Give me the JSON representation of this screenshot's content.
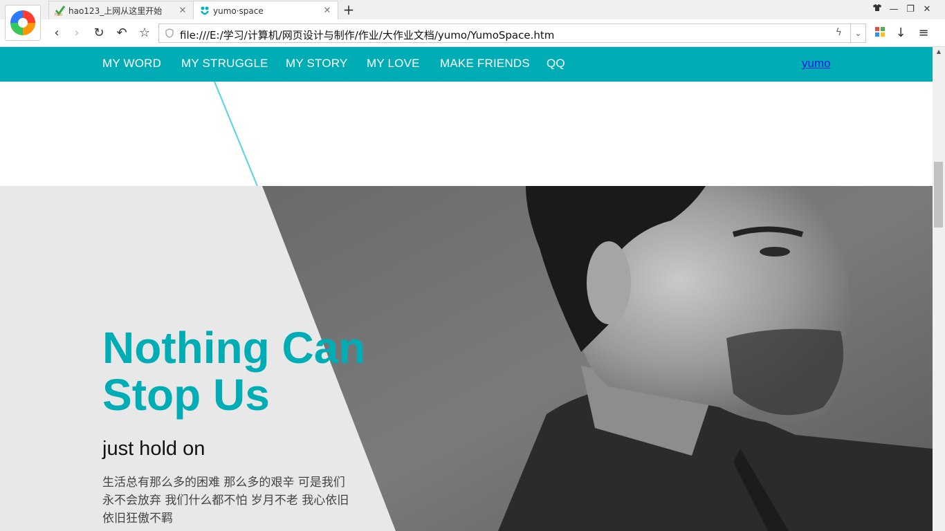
{
  "browser": {
    "tabs": [
      {
        "title": "hao123_上网从这里开始",
        "active": false,
        "icon": "hao123-favicon"
      },
      {
        "title": "yumo·space",
        "active": true,
        "icon": "yumo-favicon"
      }
    ],
    "address_url": "file:///E:/学习/计算机/网页设计与制作/作业/大作业文档/yumo/YumoSpace.htm"
  },
  "nav": {
    "items": [
      "MY WORD",
      "MY STRUGGLE",
      "MY STORY",
      "MY LOVE",
      "MAKE FRIENDS",
      "QQ"
    ],
    "user_link": "yumo"
  },
  "hero": {
    "heading_line1": "Nothing Can",
    "heading_line2": "Stop Us",
    "subheading": "just hold on",
    "body": "生活总有那么多的困难 那么多的艰辛 可是我们永不会放弃 我们什么都不怕 岁月不老 我心依旧 依旧狂傲不羁"
  },
  "colors": {
    "accent": "#00adb5",
    "link": "#1a1aee",
    "hero_bg": "#e8e8e8"
  }
}
